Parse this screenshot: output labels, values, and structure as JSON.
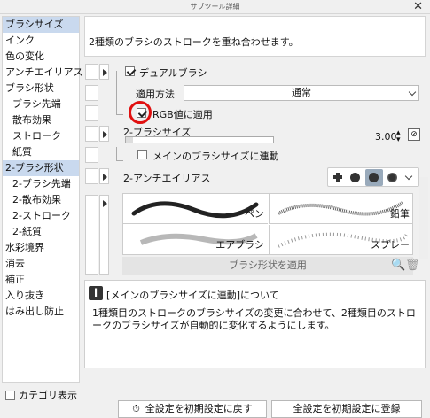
{
  "window": {
    "title": "サブツール詳細"
  },
  "sidebar": {
    "items": [
      {
        "label": "ブラシサイズ",
        "sub": false,
        "selected": true
      },
      {
        "label": "インク",
        "sub": false
      },
      {
        "label": "色の変化",
        "sub": false
      },
      {
        "label": "アンチエイリアス",
        "sub": false
      },
      {
        "label": "ブラシ形状",
        "sub": false
      },
      {
        "label": "ブラシ先端",
        "sub": true
      },
      {
        "label": "散布効果",
        "sub": true
      },
      {
        "label": "ストローク",
        "sub": true
      },
      {
        "label": "紙質",
        "sub": true
      },
      {
        "label": "2-ブラシ形状",
        "sub": false,
        "selected": true
      },
      {
        "label": "2-ブラシ先端",
        "sub": true
      },
      {
        "label": "2-散布効果",
        "sub": true
      },
      {
        "label": "2-ストローク",
        "sub": true
      },
      {
        "label": "2-紙質",
        "sub": true
      },
      {
        "label": "水彩境界",
        "sub": false
      },
      {
        "label": "消去",
        "sub": false
      },
      {
        "label": "補正",
        "sub": false
      },
      {
        "label": "入り抜き",
        "sub": false
      },
      {
        "label": "はみ出し防止",
        "sub": false
      }
    ],
    "category_label": "カテゴリ表示"
  },
  "main": {
    "description": "2種類のブラシのストロークを重ね合わせます。",
    "dual_brush_label": "デュアルブラシ",
    "apply_method_label": "適用方法",
    "apply_method_value": "通常",
    "rgb_apply_label": "RGB値に適用",
    "brush2_size_label": "2-ブラシサイズ",
    "brush2_size_value": "3.00",
    "brush2_size_fraction": 0.05,
    "link_main_size_label": "メインのブラシサイズに連動",
    "antialias2_label": "2-アンチエイリアス",
    "antialias_selected_index": 2,
    "brushes": [
      {
        "name": "ペン"
      },
      {
        "name": "鉛筆"
      },
      {
        "name": "エアブラシ"
      },
      {
        "name": "スプレー"
      }
    ],
    "apply_shape_label": "ブラシ形状を適用",
    "info_title": "[メインのブラシサイズに連動]について",
    "info_body": "1種類目のストロークのブラシサイズの変更に合わせて、2種類目のストロークのブラシサイズが自動的に変化するようにします。"
  },
  "footer": {
    "reset_label": "全設定を初期設定に戻す",
    "register_label": "全設定を初期設定に登録"
  }
}
